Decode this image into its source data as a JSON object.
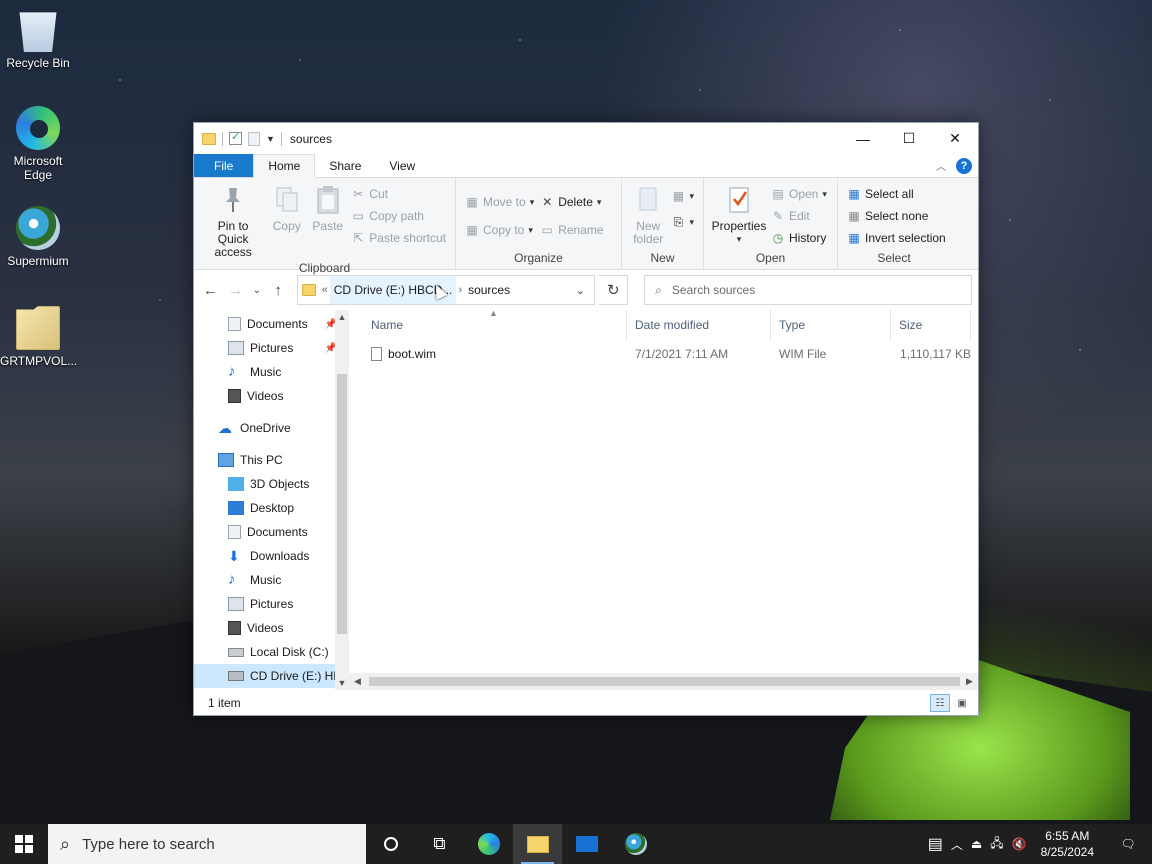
{
  "desktop": {
    "icons": [
      {
        "label": "Recycle Bin"
      },
      {
        "label": "Microsoft Edge"
      },
      {
        "label": "Supermium"
      },
      {
        "label": "GRTMPVOL..."
      }
    ]
  },
  "window": {
    "title": "sources",
    "tabs": {
      "file": "File",
      "home": "Home",
      "share": "Share",
      "view": "View"
    },
    "ribbon": {
      "clipboard": {
        "label": "Clipboard",
        "pin": "Pin to Quick access",
        "copy": "Copy",
        "paste": "Paste",
        "cut": "Cut",
        "copy_path": "Copy path",
        "paste_shortcut": "Paste shortcut"
      },
      "organize": {
        "label": "Organize",
        "move_to": "Move to",
        "copy_to": "Copy to",
        "delete": "Delete",
        "rename": "Rename"
      },
      "new": {
        "label": "New",
        "new_folder": "New folder"
      },
      "open": {
        "label": "Open",
        "properties": "Properties",
        "open": "Open",
        "edit": "Edit",
        "history": "History"
      },
      "select": {
        "label": "Select",
        "select_all": "Select all",
        "select_none": "Select none",
        "invert": "Invert selection"
      }
    },
    "address": {
      "overflow": "«",
      "drive": "CD Drive (E:) HBCD...",
      "folder": "sources"
    },
    "search_placeholder": "Search sources",
    "nav": {
      "quick": [
        {
          "label": "Documents",
          "pinned": true
        },
        {
          "label": "Pictures",
          "pinned": true
        },
        {
          "label": "Music"
        },
        {
          "label": "Videos"
        }
      ],
      "onedrive": "OneDrive",
      "thispc": "This PC",
      "pc_items": [
        "3D Objects",
        "Desktop",
        "Documents",
        "Downloads",
        "Music",
        "Pictures",
        "Videos",
        "Local Disk (C:)",
        "CD Drive (E:) HB"
      ]
    },
    "columns": {
      "name": "Name",
      "date": "Date modified",
      "type": "Type",
      "size": "Size"
    },
    "files": [
      {
        "name": "boot.wim",
        "date": "7/1/2021 7:11 AM",
        "type": "WIM File",
        "size": "1,110,117 KB"
      }
    ],
    "status": "1 item"
  },
  "taskbar": {
    "search_placeholder": "Type here to search",
    "time": "6:55 AM",
    "date": "8/25/2024"
  },
  "colors": {
    "accent": "#1979ca",
    "selected": "#cce8ff",
    "taskbar": "#1f1f1f"
  }
}
